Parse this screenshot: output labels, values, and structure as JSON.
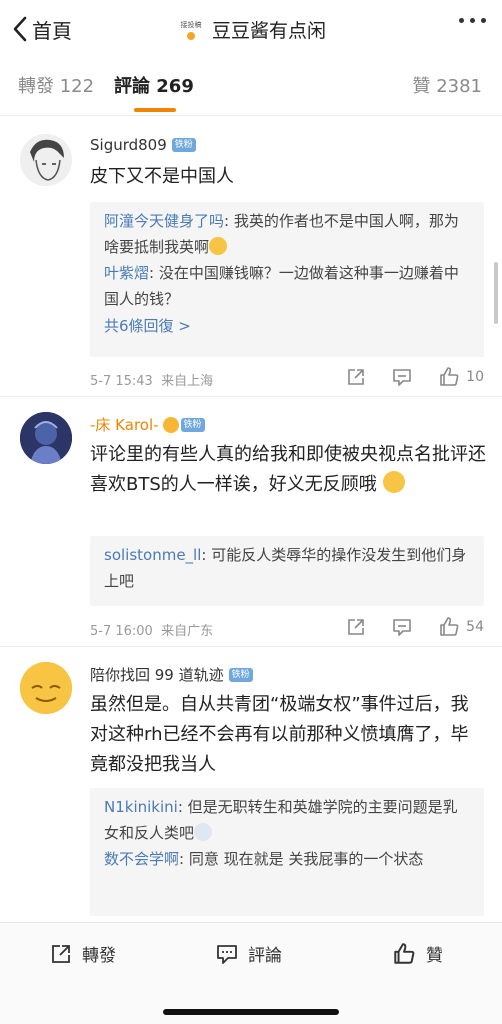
{
  "header": {
    "back_label": "首頁",
    "avatar_text": "接投稿",
    "title": "豆豆酱有点闲"
  },
  "tabs": {
    "reposts": "轉發 122",
    "comments": "評論 269",
    "likes": "贊 2381"
  },
  "comments": [
    {
      "user": "Sigurd809",
      "badge": "铁粉",
      "text": "皮下又不是中国人",
      "replies": [
        {
          "name": "阿潼今天健身了吗",
          "text": ": 我英的作者也不是中国人啊，那为啥要抵制我英啊"
        },
        {
          "name": "叶紫熠",
          "text": ": 没在中国赚钱嘛？一边做着这种事一边赚着中国人的钱？"
        }
      ],
      "more_replies": "共6條回復 >",
      "time": "5-7 15:43",
      "location": "来自上海",
      "likes": "10"
    },
    {
      "user": "-床 Karol-",
      "badge": "铁粉",
      "text": "评论里的有些人真的给我和即使被央视点名批评还喜欢BTS的人一样诶，好义无反顾哦",
      "replies": [
        {
          "name": "solistonme_ll",
          "text": ": 可能反人类辱华的操作没发生到他们身上吧"
        }
      ],
      "time": "5-7 16:00",
      "location": "来自广东",
      "likes": "54"
    },
    {
      "user": "陪你找回 99 道轨迹",
      "badge": "铁粉",
      "text": "虽然但是。自从共青团“极端女权”事件过后，我对这种rh已经不会再有以前那种义愤填膺了，毕竟都没把我当人",
      "replies": [
        {
          "name": "N1kinikini",
          "text": ": 但是无职转生和英雄学院的主要问题是乳女和反人类吧"
        },
        {
          "name": "数不会学啊",
          "text": ": 同意 现在就是 关我屁事的一个状态"
        }
      ]
    }
  ],
  "bottom": {
    "repost": "轉發",
    "comment": "評論",
    "like": "贊"
  },
  "colors": {
    "accent": "#f08500",
    "link": "#4a7bb7"
  }
}
